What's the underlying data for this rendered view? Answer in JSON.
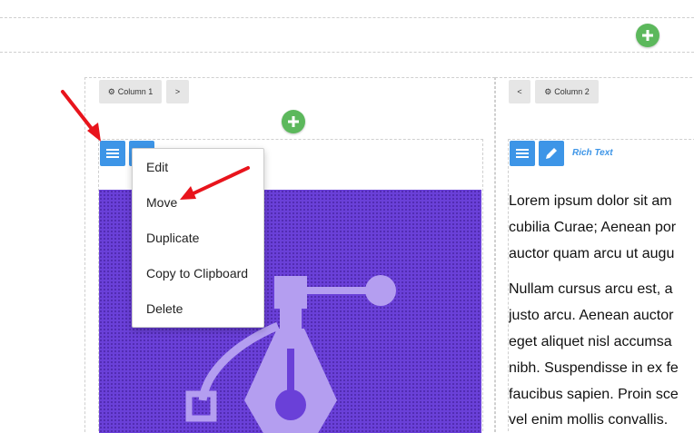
{
  "builder": {
    "row_add_icon": "plus-icon",
    "column1": {
      "settings_label": "Column 1",
      "settings_icon": "gear-icon",
      "move_right_label": ">",
      "add_icon": "plus-icon"
    },
    "column2": {
      "move_left_label": "<",
      "settings_label": "Column 2",
      "settings_icon": "gear-icon"
    },
    "block1": {
      "handle_icon": "hamburger-menu-icon",
      "edit_icon": "pencil-icon",
      "image_icon": "vector-pen-tool-icon"
    },
    "block2": {
      "handle_icon": "hamburger-menu-icon",
      "edit_icon": "pencil-icon",
      "type_label": "Rich Text"
    },
    "context_menu": {
      "items": [
        "Edit",
        "Move",
        "Duplicate",
        "Copy to Clipboard",
        "Delete"
      ]
    },
    "rich_text": {
      "paragraph1_lines": [
        "Lorem ipsum dolor sit am",
        "cubilia Curae; Aenean por",
        "auctor quam arcu ut augu"
      ],
      "paragraph2_lines": [
        "Nullam cursus arcu est, a",
        "justo arcu. Aenean auctor",
        "eget aliquet nisl accumsa",
        "nibh. Suspendisse in ex fe",
        "faucibus sapien. Proin sce",
        "vel enim mollis convallis."
      ]
    },
    "colors": {
      "add_button": "#5cb85c",
      "tool_button": "#3d95e7",
      "hero_background": "#6a40d8",
      "annotation_arrow": "#e8141c"
    }
  }
}
